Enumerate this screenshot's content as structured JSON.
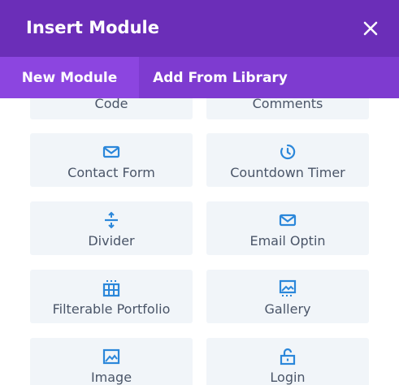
{
  "header": {
    "title": "Insert Module"
  },
  "tabs": [
    {
      "label": "New Module",
      "active": true
    },
    {
      "label": "Add From Library",
      "active": false
    }
  ],
  "modules": [
    {
      "label": "Code",
      "icon": "code-icon"
    },
    {
      "label": "Comments",
      "icon": "comments-icon"
    },
    {
      "label": "Contact Form",
      "icon": "envelope-icon"
    },
    {
      "label": "Countdown Timer",
      "icon": "timer-icon"
    },
    {
      "label": "Divider",
      "icon": "divider-icon"
    },
    {
      "label": "Email Optin",
      "icon": "envelope-icon"
    },
    {
      "label": "Filterable Portfolio",
      "icon": "grid-icon"
    },
    {
      "label": "Gallery",
      "icon": "gallery-icon"
    },
    {
      "label": "Image",
      "icon": "image-icon"
    },
    {
      "label": "Login",
      "icon": "lock-icon"
    }
  ],
  "colors": {
    "header_bg": "#6b2eb8",
    "tabs_bg": "#7e3bd0",
    "active_tab_bg": "#8c45e0",
    "module_bg": "#f1f5f9",
    "icon_blue": "#2b87da",
    "label_gray": "#4a5568"
  }
}
